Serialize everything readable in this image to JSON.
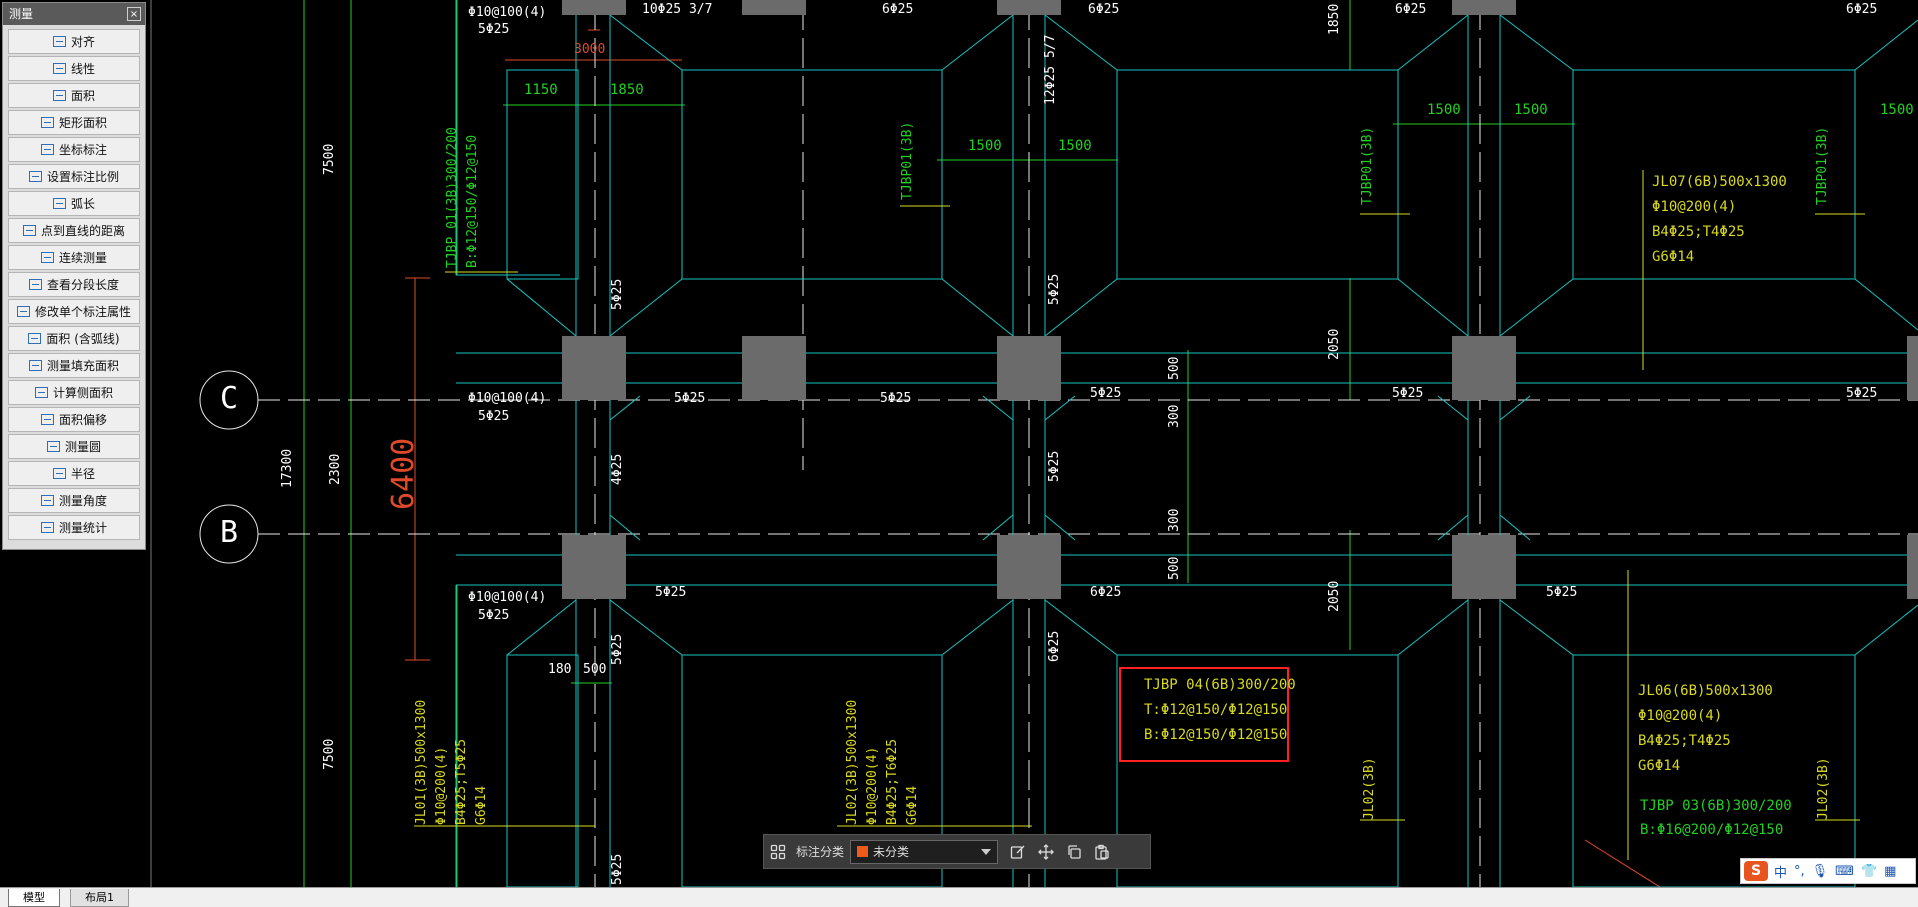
{
  "colors": {
    "background": "#000000",
    "beam_outline": "#19c2c2",
    "grid_line": "#ffffff",
    "dimension": "#22d022",
    "annotation": "#d8d820",
    "highlight_box": "#ff2020",
    "column_fill": "#6b6b6b",
    "red_dim": "#e04a2a"
  },
  "panel": {
    "title": "测量",
    "close_label": "×",
    "items": [
      {
        "label": "对齐",
        "icon": "align-icon"
      },
      {
        "label": "线性",
        "icon": "linear-icon"
      },
      {
        "label": "面积",
        "icon": "area-icon"
      },
      {
        "label": "矩形面积",
        "icon": "rect-area-icon"
      },
      {
        "label": "坐标标注",
        "icon": "coordinate-icon"
      },
      {
        "label": "设置标注比例",
        "icon": "scale-icon"
      },
      {
        "label": "弧长",
        "icon": "arc-icon"
      },
      {
        "label": "点到直线的距离",
        "icon": "point-line-icon"
      },
      {
        "label": "连续测量",
        "icon": "continuous-icon"
      },
      {
        "label": "查看分段长度",
        "icon": "segment-icon"
      },
      {
        "label": "修改单个标注属性",
        "icon": "edit-prop-icon"
      },
      {
        "label": "面积 (含弧线)",
        "icon": "arc-area-icon"
      },
      {
        "label": "测量填充面积",
        "icon": "fill-area-icon"
      },
      {
        "label": "计算侧面积",
        "icon": "side-area-icon"
      },
      {
        "label": "面积偏移",
        "icon": "offset-icon"
      },
      {
        "label": "测量圆",
        "icon": "circle-icon"
      },
      {
        "label": "半径",
        "icon": "radius-icon"
      },
      {
        "label": "测量角度",
        "icon": "angle-icon"
      },
      {
        "label": "测量统计",
        "icon": "stats-icon"
      }
    ]
  },
  "drawing": {
    "grid_labels": [
      "C",
      "B"
    ],
    "dims_top": [
      "3000",
      "1150",
      "1850",
      "1500",
      "1500",
      "1500",
      "1500",
      "1500"
    ],
    "dims_vertical": [
      "7500",
      "17300",
      "2300",
      "7500",
      "6400",
      "1850",
      "2050",
      "2050",
      "500",
      "300",
      "300",
      "500"
    ],
    "dims_small": [
      "180",
      "500"
    ],
    "rebar_labels": [
      "Φ10@100(4)",
      "5Φ25",
      "10Φ25 3/7",
      "6Φ25",
      "6Φ25",
      "6Φ25",
      "6Φ25",
      "12Φ25 5/7",
      "5Φ25",
      "5Φ25",
      "5Φ25",
      "Φ10@100(4)",
      "5Φ25",
      "5Φ25",
      "5Φ25",
      "5Φ25",
      "4Φ25",
      "5Φ25",
      "5Φ25",
      "Φ10@100(4)",
      "5Φ25",
      "5Φ25",
      "6Φ25",
      "5Φ25",
      "5Φ25",
      "6Φ25",
      "5Φ25"
    ],
    "tjbp01": [
      "TJBP 01(3B)300/200",
      "B:Φ12@150/Φ12@150"
    ],
    "tjbp_vertical": [
      "TJBP01(3B)",
      "TJBP01(3B)",
      "TJBP01(3B)"
    ],
    "jl07": [
      "JL07(6B)500x1300",
      "Φ10@200(4)",
      "B4Φ25;T4Φ25",
      "G6Φ14"
    ],
    "tjbp04": [
      "TJBP 04(6B)300/200",
      "T:Φ12@150/Φ12@150",
      "B:Φ12@150/Φ12@150"
    ],
    "jl06": [
      "JL06(6B)500x1300",
      "Φ10@200(4)",
      "B4Φ25;T4Φ25",
      "G6Φ14"
    ],
    "tjbp03": [
      "TJBP 03(6B)300/200",
      "B:Φ16@200/Φ12@150"
    ],
    "jl01": [
      "JL01(3B)500x1300",
      "Φ10@200(4)",
      "B4Φ25;T5Φ25",
      "G6Φ14"
    ],
    "jl02": [
      "JL02(3B)500x1300",
      "Φ10@200(4)",
      "B4Φ25;T6Φ25",
      "G6Φ14"
    ],
    "jl02_short": [
      "JL02(3B)",
      "JL02(3B)"
    ]
  },
  "annot_bar": {
    "category_label": "标注分类",
    "category_value": "未分类",
    "category_color": "#f05a1a"
  },
  "tabs": [
    "模型",
    "布局1"
  ],
  "ime": {
    "logo": "S",
    "lang": "中"
  }
}
